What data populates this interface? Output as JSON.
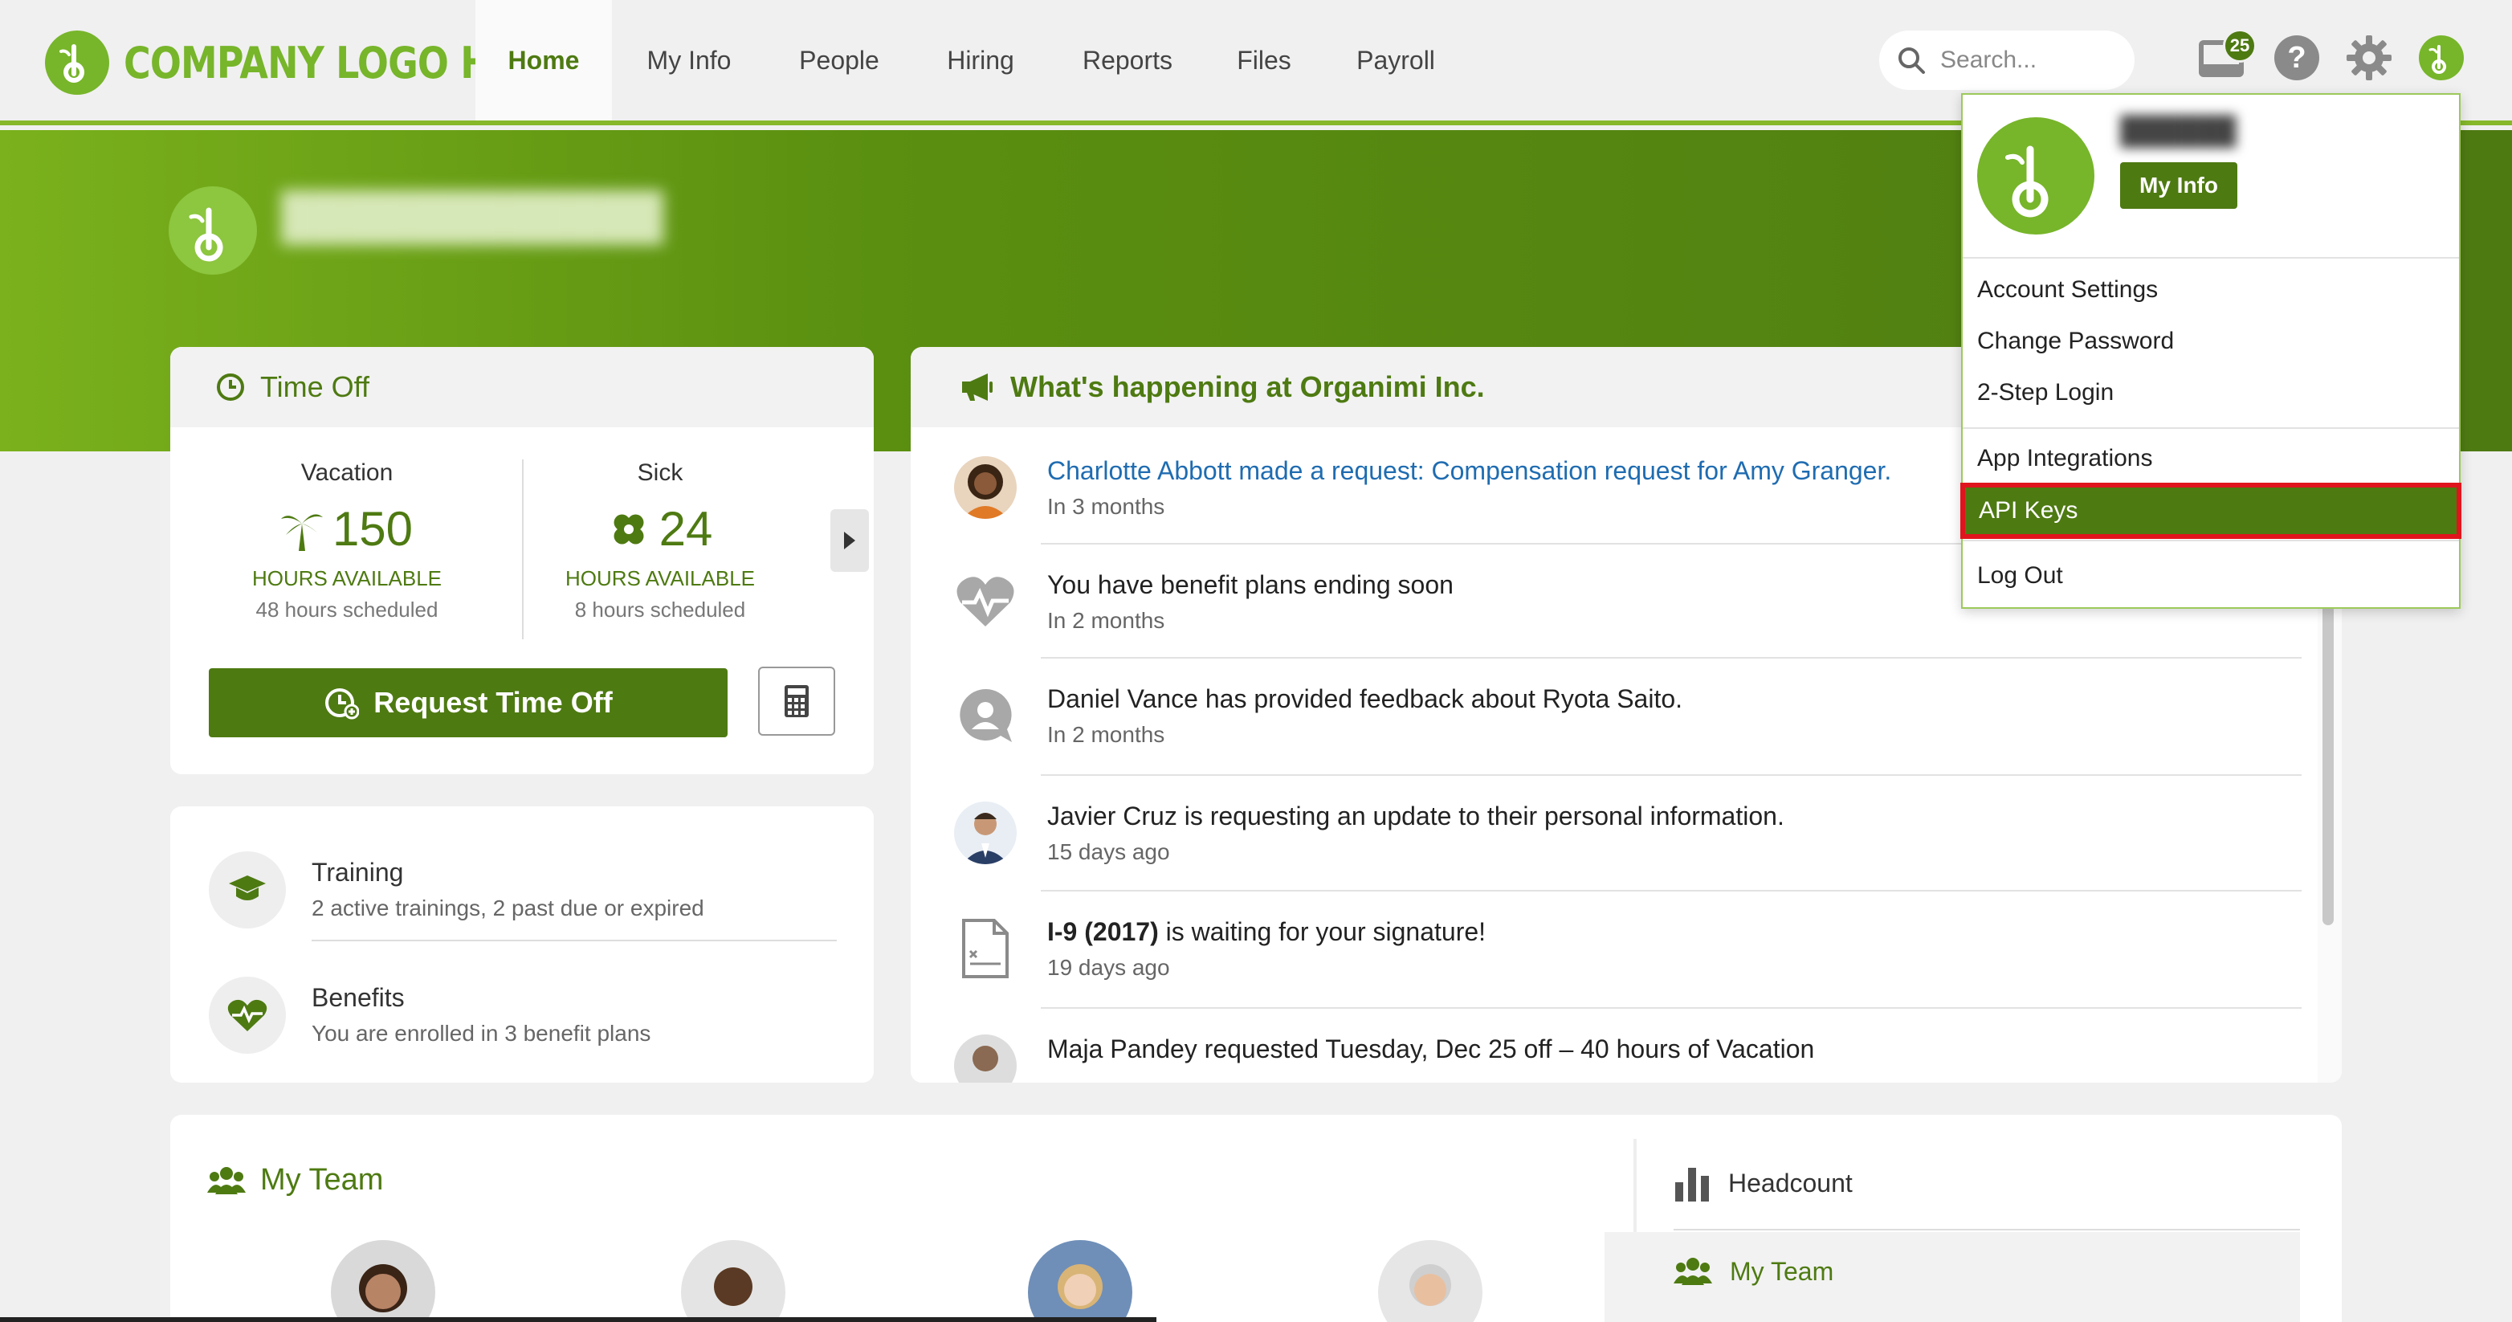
{
  "nav": {
    "logo_text": "COMPANY LOGO HERE",
    "tabs": [
      {
        "label": "Home",
        "active": true
      },
      {
        "label": "My Info"
      },
      {
        "label": "People"
      },
      {
        "label": "Hiring"
      },
      {
        "label": "Reports"
      },
      {
        "label": "Files"
      },
      {
        "label": "Payroll"
      }
    ],
    "search_placeholder": "Search...",
    "inbox_count": "25",
    "help_glyph": "?"
  },
  "time_off": {
    "title": "Time Off",
    "balances": [
      {
        "label": "Vacation",
        "value": "150",
        "unit": "HOURS AVAILABLE",
        "scheduled": "48 hours scheduled"
      },
      {
        "label": "Sick",
        "value": "24",
        "unit": "HOURS AVAILABLE",
        "scheduled": "8 hours scheduled"
      }
    ],
    "request_label": "Request Time Off"
  },
  "training_benefits": {
    "training_title": "Training",
    "training_sub": "2 active trainings, 2 past due or expired",
    "benefits_title": "Benefits",
    "benefits_sub": "You are enrolled in 3 benefit plans"
  },
  "feed": {
    "title": "What's happening at Organimi Inc.",
    "items": [
      {
        "title": "Charlotte Abbott made a request: Compensation request for Amy Granger.",
        "time": "In 3 months",
        "link": true
      },
      {
        "title": "You have benefit plans ending soon",
        "time": "In 2 months"
      },
      {
        "title": "Daniel Vance has provided feedback about Ryota Saito.",
        "time": "In 2 months"
      },
      {
        "title": "Javier Cruz is requesting an update to their personal information.",
        "time": "15 days ago"
      },
      {
        "title_bold": "I-9 (2017)",
        "title_rest": " is waiting for your signature!",
        "time": "19 days ago"
      },
      {
        "title": "Maja Pandey requested Tuesday, Dec 25 off – 40 hours of Vacation"
      }
    ]
  },
  "team": {
    "title": "My Team",
    "headcount_label": "Headcount",
    "my_team_label": "My Team"
  },
  "dropdown": {
    "my_info_label": "My Info",
    "items": [
      "Account Settings",
      "Change Password",
      "2-Step Login",
      "App Integrations",
      "API Keys",
      "Log Out"
    ]
  },
  "colors": {
    "brand_green": "#4e7a12",
    "logo_green": "#77b52a",
    "link_blue": "#1f6cb1",
    "highlight_red": "#e0141c"
  }
}
